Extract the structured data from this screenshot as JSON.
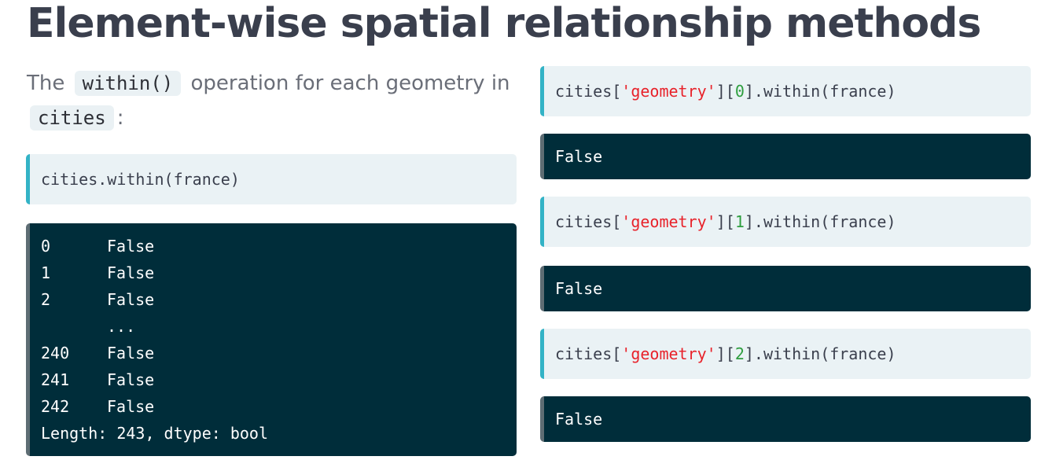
{
  "title": "Element-wise spatial relationship methods",
  "intro": {
    "prefix": "The",
    "code1": "within()",
    "middle": "operation for each geometry in",
    "code2": "cities",
    "suffix": ":"
  },
  "left_code": "cities.within(france)",
  "left_output": {
    "rows": [
      {
        "index": "0",
        "value": "False"
      },
      {
        "index": "1",
        "value": "False"
      },
      {
        "index": "2",
        "value": "False"
      },
      {
        "index": "",
        "value": "..."
      },
      {
        "index": "240",
        "value": "False"
      },
      {
        "index": "241",
        "value": "False"
      },
      {
        "index": "242",
        "value": "False"
      }
    ],
    "footer": "Length: 243, dtype: bool"
  },
  "right_blocks": [
    {
      "prefix": "cities[",
      "string": "'geometry'",
      "open": "][",
      "index": "0",
      "suffix": "].within(france)",
      "output": "False"
    },
    {
      "prefix": "cities[",
      "string": "'geometry'",
      "open": "][",
      "index": "1",
      "suffix": "].within(france)",
      "output": "False"
    },
    {
      "prefix": "cities[",
      "string": "'geometry'",
      "open": "][",
      "index": "2",
      "suffix": "].within(france)",
      "output": "False"
    }
  ],
  "colors": {
    "title": "#3a3f4d",
    "code_bg": "#eaf2f5",
    "code_accent": "#33b3c6",
    "output_bg": "#002d3a",
    "string": "#e8222a",
    "number": "#2e9e3f"
  }
}
